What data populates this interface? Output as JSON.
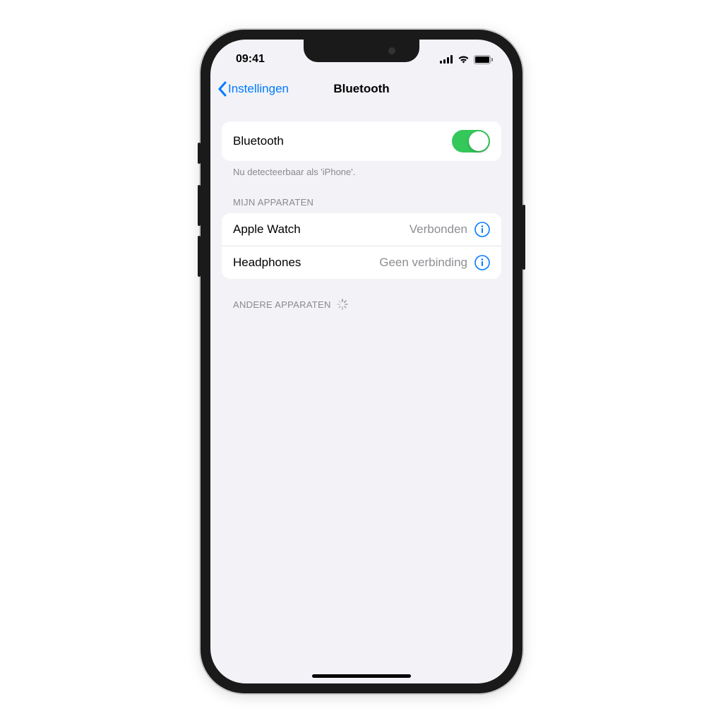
{
  "status": {
    "time": "09:41"
  },
  "nav": {
    "back_label": "Instellingen",
    "title": "Bluetooth"
  },
  "main": {
    "toggle_row_label": "Bluetooth",
    "toggle_on": true,
    "footer_text": "Nu detecteerbaar als 'iPhone'."
  },
  "sections": {
    "my_devices_header": "MIJN APPARATEN",
    "other_devices_header": "ANDERE APPARATEN"
  },
  "devices": [
    {
      "name": "Apple Watch",
      "status": "Verbonden"
    },
    {
      "name": "Headphones",
      "status": "Geen verbinding"
    }
  ],
  "colors": {
    "accent": "#007aff",
    "toggle_on": "#34c759",
    "secondary_text": "#8e8e93",
    "bg": "#f2f2f7"
  }
}
